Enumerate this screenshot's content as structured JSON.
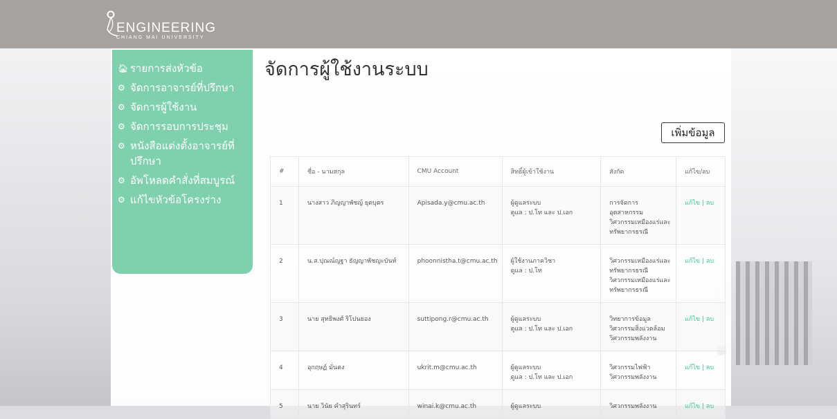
{
  "header": {
    "logo_title": "ENGINEERING",
    "logo_subtitle": "CHIANG MAI UNIVERSITY"
  },
  "sidebar": {
    "items": [
      {
        "icon": "home-icon",
        "label": "รายการส่งหัวข้อ"
      },
      {
        "icon": "gear-icon",
        "label": "จัดการอาจารย์ที่ปรึกษา"
      },
      {
        "icon": "gear-icon",
        "label": "จัดการผู้ใช้งาน"
      },
      {
        "icon": "gear-icon",
        "label": "จัดการรอบการประชุม"
      },
      {
        "icon": "gear-icon",
        "label": "หนังสือแต่งตั้งอาจารย์ที่ปรึกษา"
      },
      {
        "icon": "gear-icon",
        "label": "อัพโหลดคำสั่งที่สมบูรณ์"
      },
      {
        "icon": "gear-icon",
        "label": "แก้ไขหัวข้อโครงร่าง"
      }
    ]
  },
  "main": {
    "title": "จัดการผู้ใช้งานระบบ",
    "add_button": "เพิ่มข้อมูล"
  },
  "table": {
    "headers": [
      "#",
      "ชื่อ - นามสกุล",
      "CMU Account",
      "สิทธิ์ผู้เข้าใช้งาน",
      "สังกัด",
      "แก้ไข/ลบ"
    ],
    "rows": [
      {
        "num": "1",
        "name": "นางสาว ภิญญาพัชญ์ ยุตบุตร",
        "account": "Apisada.y@cmu.ac.th",
        "role": [
          "ผู้ดูแลระบบ",
          "ดูแล : ป.โท และ ป.เอก"
        ],
        "dept": [
          "การจัดการอุตสาหกรรม",
          "วิศวกรรมเหมืองแร่และทรัพยากรธรณี"
        ]
      },
      {
        "num": "2",
        "name": "น.ส.ปุณณ์ญฐา ธัญญาพัชญะบันท์",
        "account": "phoonnistha.t@cmu.ac.th",
        "role": [
          "ผู้ใช้งานภาควิชา",
          "ดูแล : ป.โท"
        ],
        "dept": [
          "วิศวกรรมเหมืองแร่และทรัพยากรธรณี",
          "วิศวกรรมเหมืองแร่และทรัพยากรธรณี"
        ]
      },
      {
        "num": "3",
        "name": "นาย สุทธิพงศ์ ริโปนยอง",
        "account": "suttipong.r@cmu.ac.th",
        "role": [
          "ผู้ดูแลระบบ",
          "ดูแล : ป.โท และ ป.เอก"
        ],
        "dept": [
          "วิทยาการข้อมูล",
          "วิศวกรรมสิ่งแวดล้อม",
          "วิศวกรรมพลังงาน"
        ]
      },
      {
        "num": "4",
        "name": "อุกฤษฏ์ มั่นคง",
        "account": "ukrit.m@cmu.ac.th",
        "role": [
          "ผู้ดูแลระบบ",
          "ดูแล : ป.โท และ ป.เอก"
        ],
        "dept": [
          "วิศวกรรมไฟฟ้า",
          "วิศวกรรมพลังงาน"
        ]
      },
      {
        "num": "5",
        "name": "นาย วินัย คำสุรินทร์",
        "account": "winai.k@cmu.ac.th",
        "role": [
          "ผู้ดูแลระบบ"
        ],
        "dept": [
          "วิศวกรรมพลังงาน"
        ]
      }
    ],
    "edit_label": "แก้ไข",
    "delete_label": "ลบ",
    "separator": "|"
  }
}
